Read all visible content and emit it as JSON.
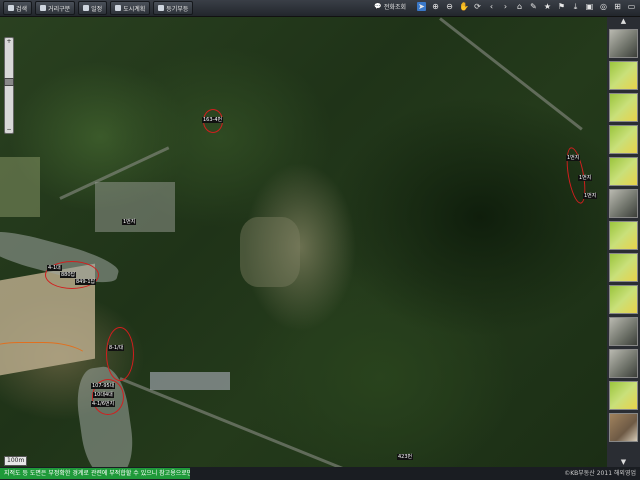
{
  "toolbar": {
    "buttons": [
      {
        "label": "검색"
      },
      {
        "label": "거리구분"
      },
      {
        "label": "일정"
      },
      {
        "label": "도시계획"
      },
      {
        "label": "등기부등"
      }
    ],
    "news_label": "전화조회"
  },
  "map": {
    "parcel_labels": [
      "163-4번",
      "1번지",
      "1번지",
      "1번지",
      "4-1대",
      "880답",
      "849-1답",
      "1번지",
      "8-1/대",
      "107-95대",
      "10대4대",
      "4-1/6번지",
      "423번"
    ],
    "scale_text": "100m"
  },
  "status": {
    "message": "지적도 등 도면은 부정확한 경계로 관련에 부적합할 수 있으니 참고용으로만 사용하시기 바랍니다.",
    "copyright": "©KB부동산 2011 해외영업"
  },
  "colors": {
    "accent": "#3a78c8",
    "status_green": "#1f9a3a",
    "parcel_red": "#d21e1e",
    "boundary_orange": "#e07020"
  }
}
